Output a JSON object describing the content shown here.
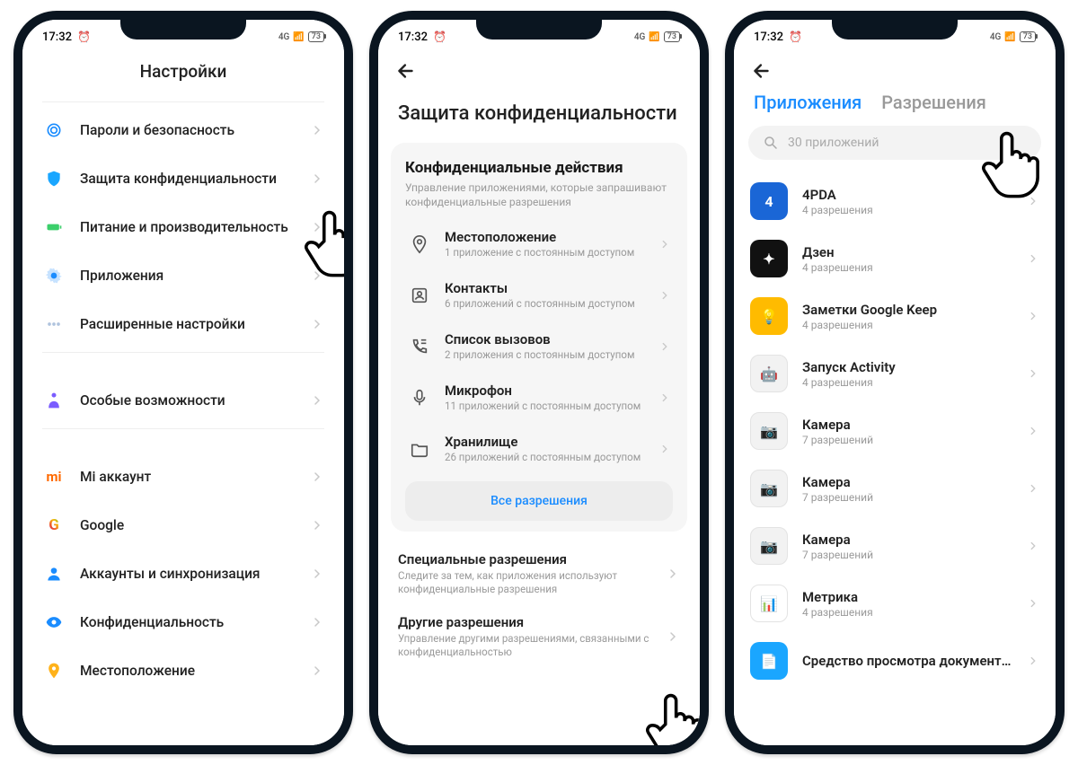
{
  "status": {
    "time": "17:32",
    "battery": "73",
    "signal": "4G"
  },
  "phone1": {
    "title": "Настройки",
    "rows1": [
      {
        "label": "Пароли и безопасность",
        "icon": "fingerprint",
        "color": "#1a8cff"
      },
      {
        "label": "Защита конфиденциальности",
        "icon": "shield",
        "color": "#1aa6ff"
      },
      {
        "label": "Питание и производительность",
        "icon": "battery",
        "color": "#3bcf6b"
      },
      {
        "label": "Приложения",
        "icon": "gear",
        "color": "#1a8cff"
      },
      {
        "label": "Расширенные настройки",
        "icon": "dots",
        "color": "#b0c4de"
      }
    ],
    "rows2": [
      {
        "label": "Особые возможности",
        "icon": "access",
        "color": "#7a5cff"
      }
    ],
    "rows3": [
      {
        "label": "Mi аккаунт",
        "icon": "mi",
        "color": "#ff6a00"
      },
      {
        "label": "Google",
        "icon": "google",
        "color": ""
      },
      {
        "label": "Аккаунты и синхронизация",
        "icon": "person",
        "color": "#1a8cff"
      },
      {
        "label": "Конфиденциальность",
        "icon": "eye",
        "color": "#1a8cff"
      },
      {
        "label": "Местоположение",
        "icon": "location",
        "color": "#ffb21a"
      }
    ]
  },
  "phone2": {
    "title": "Защита конфиденциальности",
    "card_title": "Конфиденциальные действия",
    "card_sub": "Управление приложениями, которые запрашивают конфиденциальные разрешения",
    "perms": [
      {
        "label": "Местоположение",
        "sub": "1 приложение с постоянным доступом",
        "icon": "pin"
      },
      {
        "label": "Контакты",
        "sub": "6 приложений с постоянным доступом",
        "icon": "contact"
      },
      {
        "label": "Список вызовов",
        "sub": "2 приложения с постоянным доступом",
        "icon": "callog"
      },
      {
        "label": "Микрофон",
        "sub": "11 приложений с постоянным доступом",
        "icon": "mic"
      },
      {
        "label": "Хранилище",
        "sub": "26 приложений с постоянным доступом",
        "icon": "folder"
      }
    ],
    "all_button": "Все разрешения",
    "special": {
      "title": "Специальные разрешения",
      "sub": "Следите за тем, как приложения используют конфиденциальные разрешения"
    },
    "other": {
      "title": "Другие разрешения",
      "sub": "Управление другими разрешениями, связанными с конфиденциальностью"
    }
  },
  "phone3": {
    "tab_apps": "Приложения",
    "tab_perms": "Разрешения",
    "search_placeholder": "30 приложений",
    "apps": [
      {
        "name": "4PDA",
        "sub": "4 разрешения",
        "bg": "#1a66d6",
        "glyph": "4"
      },
      {
        "name": "Дзен",
        "sub": "4 разрешения",
        "bg": "#111",
        "glyph": "✦"
      },
      {
        "name": "Заметки Google Keep",
        "sub": "4 разрешения",
        "bg": "#ffbb00",
        "glyph": "💡"
      },
      {
        "name": "Запуск Activity",
        "sub": "4 разрешения",
        "bg": "#f2f2f2",
        "glyph": "🤖"
      },
      {
        "name": "Камера",
        "sub": "7 разрешений",
        "bg": "#f2f2f2",
        "glyph": "📷"
      },
      {
        "name": "Камера",
        "sub": "7 разрешений",
        "bg": "#f2f2f2",
        "glyph": "📷"
      },
      {
        "name": "Камера",
        "sub": "7 разрешений",
        "bg": "#f2f2f2",
        "glyph": "📷"
      },
      {
        "name": "Метрика",
        "sub": "4 разрешения",
        "bg": "#fff",
        "glyph": "📊"
      },
      {
        "name": "Средство просмотра документ...",
        "sub": "",
        "bg": "#1aa6ff",
        "glyph": "📄"
      }
    ]
  }
}
